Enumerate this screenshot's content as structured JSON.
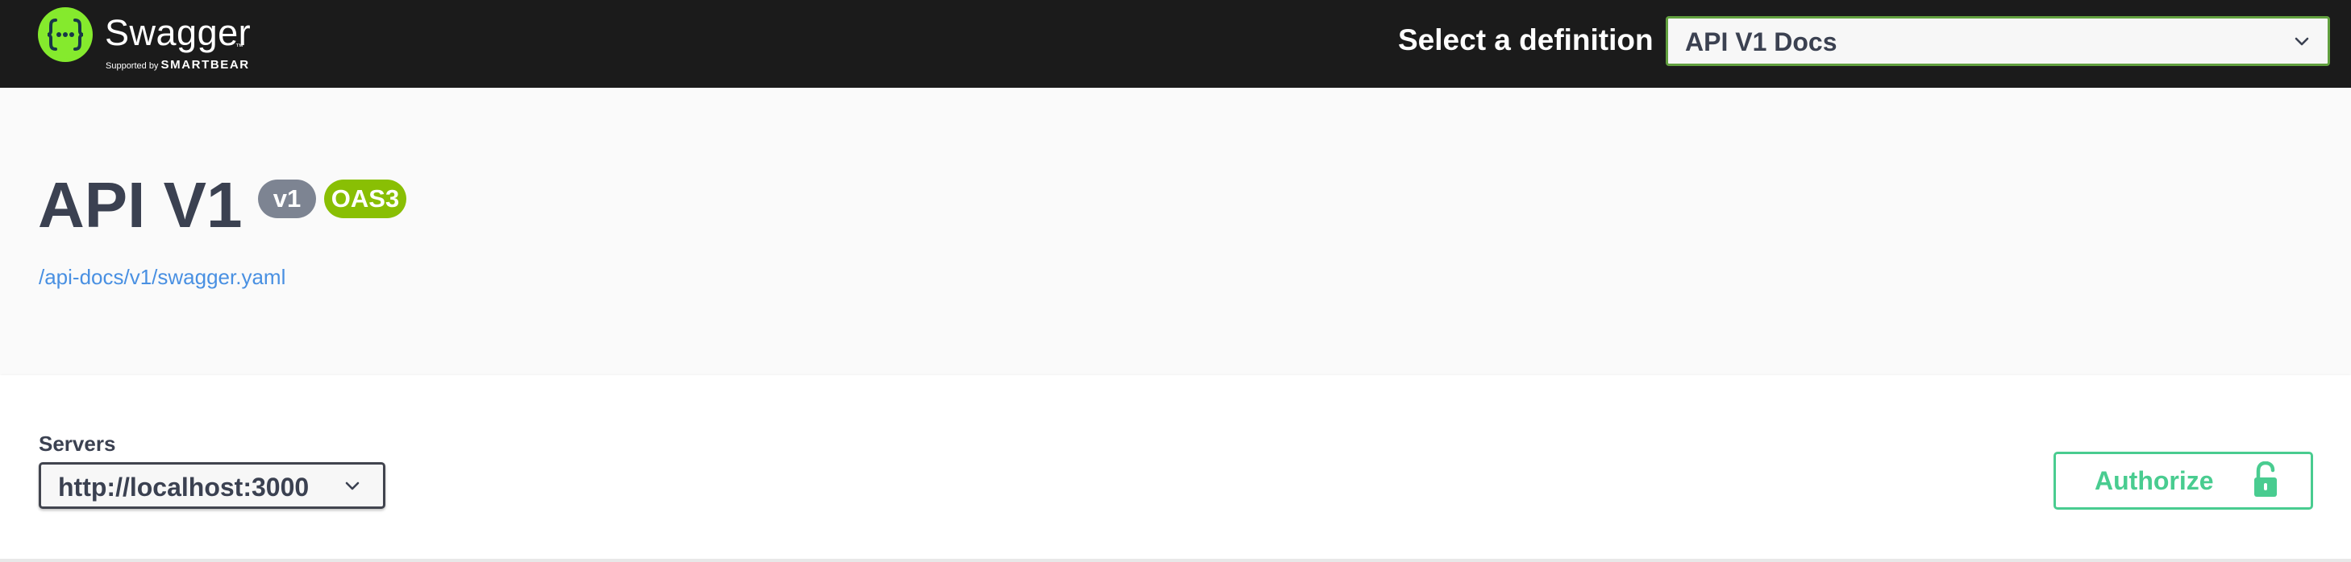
{
  "header": {
    "logo": {
      "wordmark": "Swagger",
      "trademark": "™",
      "supported_by": "Supported by",
      "brand": "SMARTBEAR",
      "icon": "swagger-braces-icon",
      "accent_color": "#85ea2d"
    },
    "definition_label": "Select a definition",
    "definition_selected": "API V1 Docs",
    "border_color": "#62a03f"
  },
  "info": {
    "title": "API V1",
    "version_badge": "v1",
    "oas_badge": "OAS3",
    "spec_url": "/api-docs/v1/swagger.yaml",
    "version_badge_color": "#7d8492",
    "oas_badge_color": "#89bf04",
    "link_color": "#4990e2"
  },
  "servers": {
    "label": "Servers",
    "selected": "http://localhost:3000"
  },
  "authorize": {
    "label": "Authorize",
    "icon": "unlocked-padlock-icon",
    "color": "#49cc90"
  }
}
